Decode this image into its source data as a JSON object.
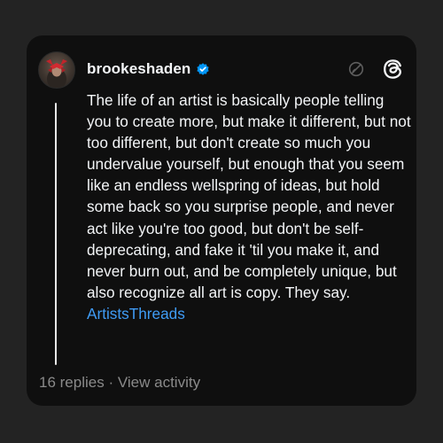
{
  "post": {
    "username": "brookeshaden",
    "verified": true,
    "body_text": "The life of an artist is basically people telling you to create more, but make it different, but not too different, but don't create so much you undervalue yourself, but enough that you seem like an endless wellspring of ideas, but hold some back so you surprise people, and never act like you're too good, but don't be self-deprecating, and fake it 'til you make it, and never burn out, and be completely unique, but also recognize all art is copy. They say.",
    "tag": "ArtistsThreads",
    "replies": "16 replies",
    "separator": "·",
    "view_activity": "View activity"
  },
  "icons": {
    "verified": "verified-badge-icon",
    "mute": "mute-icon",
    "app": "threads-logo-icon"
  },
  "colors": {
    "background": "#232323",
    "card": "#0f0f0f",
    "text": "#f3f5f7",
    "muted": "#8a8a8a",
    "link": "#3f9cf5",
    "verified": "#0095f6"
  }
}
